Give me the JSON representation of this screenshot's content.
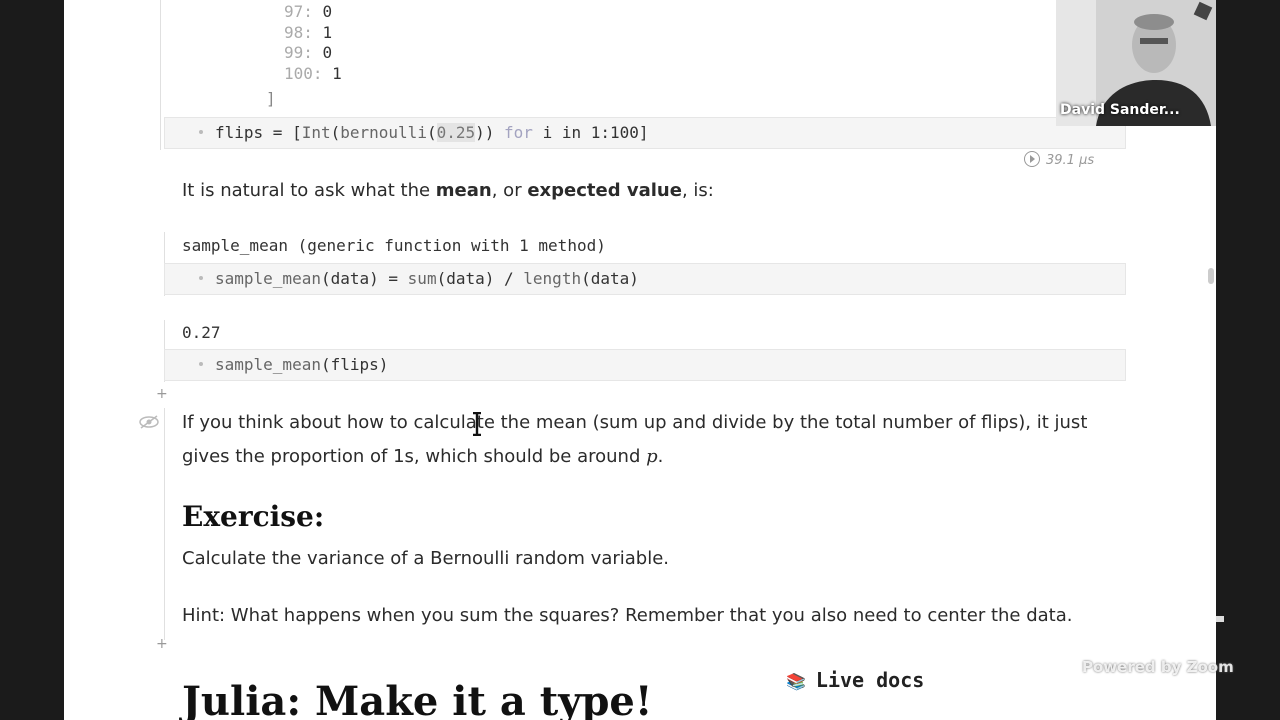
{
  "array_output": {
    "rows": [
      {
        "index": "97:",
        "value": "0"
      },
      {
        "index": "98:",
        "value": "1"
      },
      {
        "index": "99:",
        "value": "0"
      },
      {
        "index": "100:",
        "value": "1"
      }
    ],
    "closing": "]"
  },
  "flips_cell": {
    "code_parts": {
      "a": "flips = [",
      "b": "Int",
      "c": "(",
      "d": "bernoulli",
      "e": "(",
      "f": "0.25",
      "g": ")) ",
      "h": "for",
      "i": " i ",
      "j": "in",
      "k": " 1:100]"
    },
    "runtime": "39.1 µs"
  },
  "text_mean_intro": {
    "pre": "It is natural to ask what the ",
    "b1": "mean",
    "mid": ", or ",
    "b2": "expected value",
    "post": ", is:"
  },
  "sample_mean_cell": {
    "output": "sample_mean (generic function with 1 method)",
    "code_parts": {
      "a": "sample_mean",
      "b": "(data) = ",
      "c": "sum",
      "d": "(data) / ",
      "e": "length",
      "f": "(data)"
    }
  },
  "flips_mean_cell": {
    "output": "0.27",
    "code_parts": {
      "a": "sample_mean",
      "b": "(flips)"
    }
  },
  "paragraph_mean": {
    "line1": "If you think about how to calculate the mean (sum up and divide by the total number of flips), it just",
    "line2_pre": "gives the proportion of 1s, which should be around ",
    "line2_var": "p",
    "line2_post": "."
  },
  "exercise": {
    "title": "Exercise:",
    "task": "Calculate the variance of a Bernoulli random variable.",
    "hint": "Hint: What happens when you sum the squares? Remember that you also need to center the data."
  },
  "next_heading": "Julia: Make it a type!",
  "live_docs": {
    "label": "Live docs"
  },
  "video": {
    "name": "David Sander..."
  },
  "watermark": "Powered by Zoom"
}
